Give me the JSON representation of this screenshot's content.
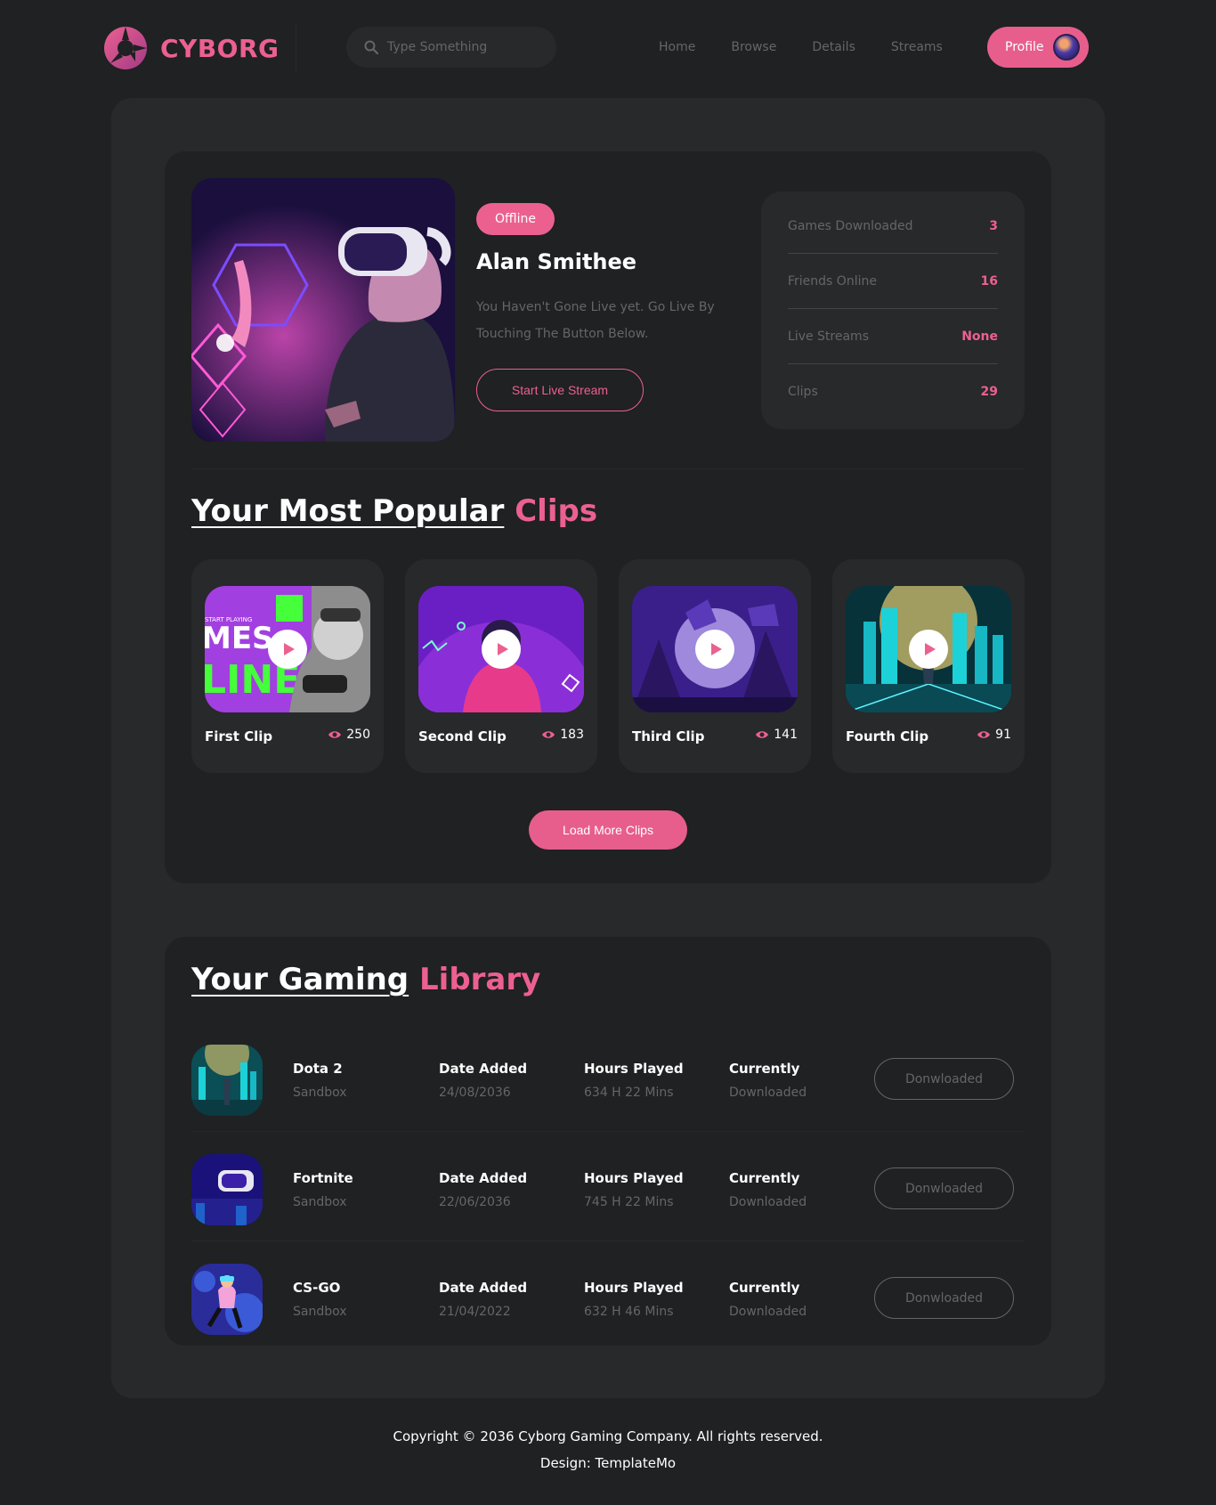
{
  "brand": {
    "name": "CYBORG"
  },
  "search": {
    "placeholder": "Type Something"
  },
  "nav": {
    "items": [
      "Home",
      "Browse",
      "Details",
      "Streams"
    ],
    "profile_label": "Profile"
  },
  "profile": {
    "status": "Offline",
    "name": "Alan Smithee",
    "description": "You Haven't Gone Live yet. Go Live By Touching The Button Below.",
    "live_button": "Start Live Stream",
    "stats": [
      {
        "label": "Games Downloaded",
        "value": "3"
      },
      {
        "label": "Friends Online",
        "value": "16"
      },
      {
        "label": "Live Streams",
        "value": "None"
      },
      {
        "label": "Clips",
        "value": "29"
      }
    ]
  },
  "clips": {
    "heading_main": "Your Most Popular",
    "heading_accent": "Clips",
    "items": [
      {
        "title": "First Clip",
        "views": "250"
      },
      {
        "title": "Second Clip",
        "views": "183"
      },
      {
        "title": "Third Clip",
        "views": "141"
      },
      {
        "title": "Fourth Clip",
        "views": "91"
      }
    ],
    "load_more": "Load More Clips"
  },
  "library": {
    "heading_main": "Your Gaming",
    "heading_accent": "Library",
    "rows": [
      {
        "game": "Dota 2",
        "genre": "Sandbox",
        "date_label": "Date Added",
        "date": "24/08/2036",
        "hours_label": "Hours Played",
        "hours": "634 H 22 Mins",
        "status_label": "Currently",
        "status": "Downloaded",
        "button": "Donwloaded"
      },
      {
        "game": "Fortnite",
        "genre": "Sandbox",
        "date_label": "Date Added",
        "date": "22/06/2036",
        "hours_label": "Hours Played",
        "hours": "745 H 22 Mins",
        "status_label": "Currently",
        "status": "Downloaded",
        "button": "Donwloaded"
      },
      {
        "game": "CS-GO",
        "genre": "Sandbox",
        "date_label": "Date Added",
        "date": "21/04/2022",
        "hours_label": "Hours Played",
        "hours": "632 H 46 Mins",
        "status_label": "Currently",
        "status": "Downloaded",
        "button": "Donwloaded"
      }
    ]
  },
  "footer": {
    "copyright": "Copyright © 2036 Cyborg Gaming Company. All rights reserved.",
    "design": "Design: TemplateMo"
  },
  "colors": {
    "accent": "#ec6090",
    "bg": "#1f2122",
    "panel": "#27292a",
    "muted": "#666666"
  }
}
